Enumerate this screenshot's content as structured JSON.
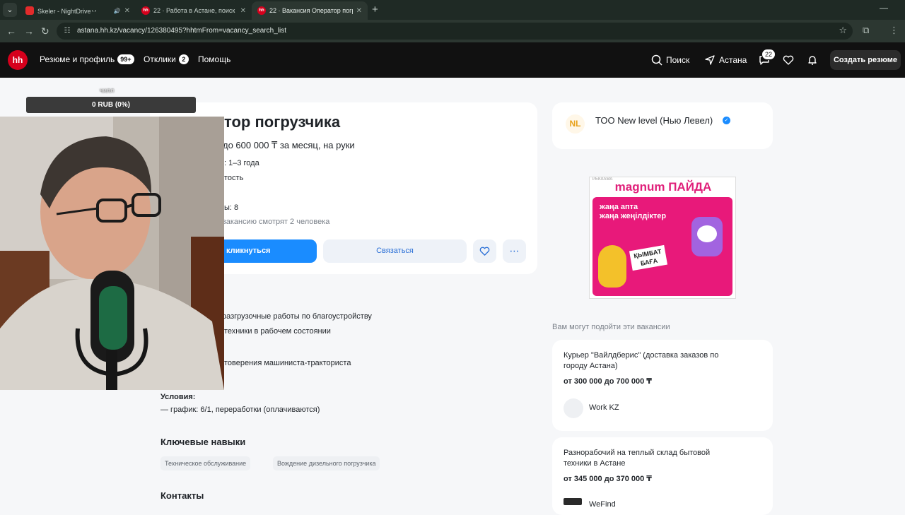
{
  "browser": {
    "tabs": [
      {
        "title": "Skeler - NightDrive丷",
        "favicon": "youtube",
        "audio": true
      },
      {
        "title": "22 · Работа в Астане, поиск п",
        "favicon": "hh"
      },
      {
        "title": "22 · Вакансия Оператор погру",
        "favicon": "hh",
        "active": true
      }
    ],
    "url": "astana.hh.kz/vacancy/126380495?hhtmFrom=vacancy_search_list"
  },
  "header": {
    "logo": "hh",
    "nav": [
      {
        "label": "Резюме и профиль",
        "badge": "99+"
      },
      {
        "label": "Отклики",
        "badge": "2"
      },
      {
        "label": "Помощь"
      }
    ],
    "search_label": "Поиск",
    "city_label": "Астана",
    "messages_badge": "22",
    "create_resume_label": "Создать резюме"
  },
  "vacancy": {
    "title_visible": "тор погрузчика",
    "salary_visible": "до 600 000 ₸ за месяц, на руки",
    "experience_visible": ": 1–3 года",
    "employment_visible": "тость",
    "shifts_visible": "ы: 8",
    "viewers_visible": "вакансию смотрят 2 человека",
    "respond_label": "кликнуться",
    "contact_label": "Связаться",
    "duties": [
      "разгрузочные работы по благоустройству",
      "техники в рабочем состоянии"
    ],
    "requirement": "товерения машиниста-тракториста",
    "conditions_title": "Условия:",
    "conditions_item": "— график: 6/1, переработки (оплачиваются)",
    "skills_title": "Ключевые навыки",
    "skills": [
      "Техническое обслуживание",
      "Вождение дизельного погрузчика"
    ],
    "contacts_title": "Контакты"
  },
  "company": {
    "name": "ТОО New level (Нью Левел)",
    "logo_text": "NL"
  },
  "ad": {
    "label": "РЕКЛАМА",
    "brand": "magnum ПАЙДА",
    "slogan_1": "жаңа апта",
    "slogan_2": "жаңа жеңілдіктер",
    "tag_1": "ҚЫМБАТ",
    "tag_2": "БАҒА"
  },
  "suggestions": {
    "label": "Вам могут подойти эти вакансии",
    "items": [
      {
        "title_1": "Курьер \"Вайлдберис\" (доставка заказов по",
        "title_2": "городу Астана)",
        "salary": "от 300 000 до 700 000 ₸",
        "company": "Work KZ"
      },
      {
        "title_1": "Разнорабочий на теплый склад бытовой",
        "title_2": "техники в Астане",
        "salary": "от 345 000 до 370 000 ₸",
        "company": "WeFind"
      }
    ]
  },
  "stream_overlay": {
    "label": "чилл",
    "progress_text": "0 RUB (0%)",
    "progress": 0
  },
  "colors": {
    "hh_red": "#d6001c",
    "primary_blue": "#1a8cff",
    "header_bg": "#111111"
  }
}
